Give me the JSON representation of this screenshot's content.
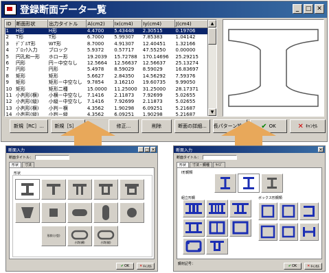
{
  "main": {
    "title": "登録断面データ一覧",
    "columns": [
      "ID",
      "断面形状",
      "出力タイトル",
      "A(cm2)",
      "Ix(cm4)",
      "Iy(cm4)",
      "J(cm4)"
    ],
    "rows": [
      [
        "1",
        "H形",
        "H形",
        "4.4700",
        "5.43448",
        "2.30515",
        "0.19706"
      ],
      [
        "2",
        "T形",
        "T形",
        "6.7000",
        "5.99307",
        "7.85383",
        "1.04142"
      ],
      [
        "3",
        "ﾃﾞﾌﾞﾙT形",
        "WT形",
        "8.7000",
        "4.91307",
        "12.40451",
        "1.32166"
      ],
      [
        "4",
        "ﾌﾞﾛｯｸ入力",
        "ブロック",
        "5.9372",
        "0.57717",
        "47.55250",
        "0.00000"
      ],
      [
        "5",
        "円孔和一形",
        "ホロー形",
        "19.2039",
        "15.72788",
        "170.14696",
        "25.29215"
      ],
      [
        "6",
        "円形",
        "円－中空なし",
        "12.5664",
        "12.56637",
        "12.56637",
        "25.13274"
      ],
      [
        "7",
        "円形",
        "円形",
        "5.4978",
        "8.59029",
        "8.59029",
        "16.83697"
      ],
      [
        "8",
        "矩形",
        "矩形",
        "5.6627",
        "2.84350",
        "14.56292",
        "7.59376"
      ],
      [
        "9",
        "矩形",
        "矩形－中空なし",
        "9.7854",
        "3.16210",
        "19.60735",
        "9.99050"
      ],
      [
        "10",
        "矩形",
        "矩形二種",
        "15.0000",
        "11.25000",
        "31.25000",
        "28.17371"
      ],
      [
        "11",
        "小判形(横)",
        "小横－中空なし",
        "7.1416",
        "2.11873",
        "7.92699",
        "5.02655"
      ],
      [
        "12",
        "小判形(縦)",
        "小縦－中空なし",
        "7.1416",
        "7.92699",
        "2.11873",
        "5.02655"
      ],
      [
        "13",
        "小判形(横)",
        "小判－横",
        "4.3562",
        "1.90298",
        "6.09251",
        "5.21687"
      ],
      [
        "14",
        "小判形(縦)",
        "小判－縦",
        "4.3562",
        "6.09251",
        "1.90298",
        "5.21687"
      ]
    ],
    "buttons": {
      "new_rc": "新規［RC］...",
      "new_s": "新規［S］...",
      "edit": "修正...",
      "delete": "削除",
      "details": "断面の詳細...",
      "length_settings": "長パターン設定",
      "ok": "OK",
      "cancel": "ｷｬﾝｾﾙ"
    }
  },
  "dialog_left": {
    "title": "断面入力",
    "name_label": "断面タイトル：",
    "tabs": [
      "形状",
      "寸法"
    ],
    "group_label": "形状",
    "tile_labels": {
      "oval_h": "小判(横)",
      "oval_v": "小判(縦)",
      "ring_rect": "矩形(小)",
      "custom": "形状(小型)"
    },
    "ok": "OK",
    "cancel": "ｷｬﾝｾﾙ"
  },
  "dialog_right": {
    "title": "断面入力",
    "name_label": "断面タイトル：",
    "tabs": [
      "形状",
      "寸法・鋼種",
      "ｻｲｽﾞ"
    ],
    "group1_label": "I形鋼類",
    "group2_label": "組立形鋼",
    "group3_label": "ボックス形鋼類",
    "footer_label": "鋼材記号：",
    "ok": "OK",
    "cancel": "ｷｬﾝｾﾙ"
  },
  "colors": {
    "title_bar": "#0a246a",
    "selection": "#0a246a",
    "arrow": "#e8a85a",
    "shape_blue": "#1c2fb4"
  }
}
